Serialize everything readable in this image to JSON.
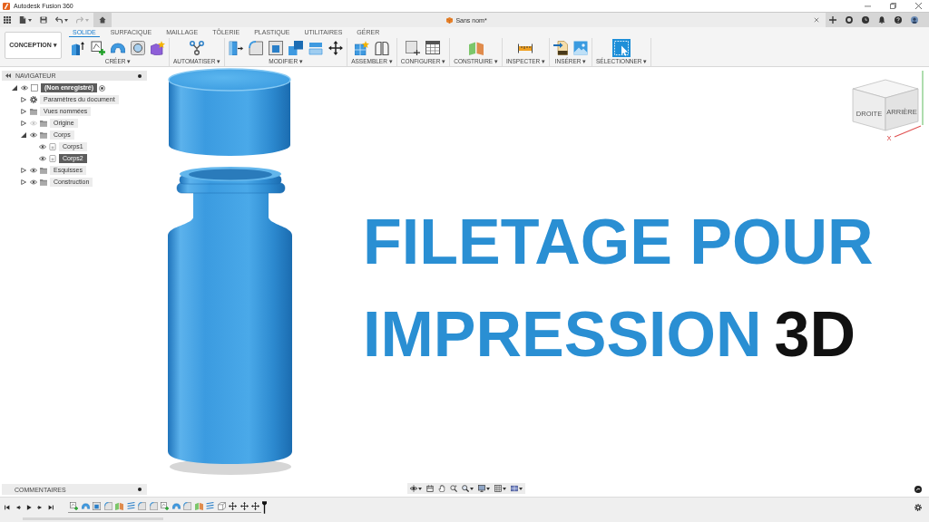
{
  "window": {
    "title": "Autodesk Fusion 360"
  },
  "quick_access": [
    {
      "kind": "apps",
      "dropdown": false,
      "disabled": false
    },
    {
      "kind": "file",
      "dropdown": true,
      "disabled": false
    },
    {
      "kind": "save",
      "dropdown": false,
      "disabled": false
    },
    {
      "kind": "undo",
      "dropdown": true,
      "disabled": false
    },
    {
      "kind": "redo",
      "dropdown": true,
      "disabled": true
    },
    {
      "kind": "home",
      "dropdown": false,
      "disabled": false
    }
  ],
  "document_tab": {
    "title": "Sans nom*"
  },
  "header_tools": [
    {
      "kind": "plus"
    },
    {
      "kind": "extensions"
    },
    {
      "kind": "jobs"
    },
    {
      "kind": "bell"
    },
    {
      "kind": "help"
    },
    {
      "kind": "avatar"
    }
  ],
  "workspace": {
    "label": "CONCEPTION ▾"
  },
  "tabs": [
    {
      "label": "SOLIDE",
      "selected": true
    },
    {
      "label": "SURFACIQUE",
      "selected": false
    },
    {
      "label": "MAILLAGE",
      "selected": false
    },
    {
      "label": "TÔLERIE",
      "selected": false
    },
    {
      "label": "PLASTIQUE",
      "selected": false
    },
    {
      "label": "UTILITAIRES",
      "selected": false
    },
    {
      "label": "GÉRER",
      "selected": false
    }
  ],
  "tool_groups": [
    {
      "label": "CRÉER ▾",
      "tools": [
        {
          "kind": "extrude"
        },
        {
          "kind": "sketch"
        },
        {
          "kind": "sweep"
        },
        {
          "kind": "hole"
        },
        {
          "kind": "form"
        }
      ]
    },
    {
      "label": "AUTOMATISER ▾",
      "tools": [
        {
          "kind": "automate"
        }
      ]
    },
    {
      "label": "MODIFIER ▾",
      "tools": [
        {
          "kind": "presspull"
        },
        {
          "kind": "fillet"
        },
        {
          "kind": "shell"
        },
        {
          "kind": "combine"
        },
        {
          "kind": "replace"
        },
        {
          "kind": "move"
        }
      ]
    },
    {
      "label": "ASSEMBLER ▾",
      "tools": [
        {
          "kind": "component"
        },
        {
          "kind": "joint"
        }
      ]
    },
    {
      "label": "CONFIGURER ▾",
      "tools": [
        {
          "kind": "parameters"
        },
        {
          "kind": "table"
        }
      ]
    },
    {
      "label": "CONSTRUIRE ▾",
      "tools": [
        {
          "kind": "plane"
        }
      ]
    },
    {
      "label": "INSPECTER ▾",
      "tools": [
        {
          "kind": "measure"
        }
      ]
    },
    {
      "label": "INSÉRER ▾",
      "tools": [
        {
          "kind": "insert"
        },
        {
          "kind": "image"
        }
      ]
    },
    {
      "label": "SÉLECTIONNER ▾",
      "tools": [
        {
          "kind": "select"
        }
      ]
    }
  ],
  "navigator": {
    "title": "NAVIGATEUR",
    "tree": [
      {
        "label": "(Non enregistré)",
        "kind": "document",
        "expanded": true,
        "visible": true,
        "selected": true,
        "children": [
          {
            "label": "Paramètres du document",
            "kind": "settings",
            "expanded": false,
            "selected": false
          },
          {
            "label": "Vues nommées",
            "kind": "folder",
            "expanded": false,
            "selected": false
          },
          {
            "label": "Origine",
            "kind": "folder",
            "expanded": false,
            "visible": false,
            "selected": false
          },
          {
            "label": "Corps",
            "kind": "folder",
            "expanded": true,
            "visible": true,
            "selected": false,
            "children": [
              {
                "label": "Corps1",
                "kind": "body",
                "visible": true,
                "selected": false
              },
              {
                "label": "Corps2",
                "kind": "body",
                "visible": true,
                "selected": true
              }
            ]
          },
          {
            "label": "Esquisses",
            "kind": "folder",
            "expanded": false,
            "visible": true,
            "selected": false
          },
          {
            "label": "Construction",
            "kind": "folder",
            "expanded": false,
            "visible": true,
            "selected": false
          }
        ]
      }
    ]
  },
  "viewcube": {
    "faces": [
      "DROITE",
      "ARRIÈRE"
    ],
    "axis": "X"
  },
  "headline": {
    "lines": [
      {
        "parts": [
          {
            "text": "FILETAGE POUR",
            "color": "#2a8fd3"
          }
        ]
      },
      {
        "parts": [
          {
            "text": "IMPRESSION",
            "color": "#2a8fd3"
          },
          {
            "text": "3D",
            "color": "#111111"
          }
        ]
      }
    ]
  },
  "comments": {
    "title": "COMMENTAIRES"
  },
  "nav_bar": [
    {
      "kind": "orbit",
      "dropdown": true
    },
    {
      "kind": "lookat",
      "dropdown": false
    },
    {
      "kind": "pan",
      "dropdown": false
    },
    {
      "kind": "zoom",
      "dropdown": false
    },
    {
      "kind": "fit",
      "dropdown": true
    },
    {
      "kind": "display",
      "dropdown": true
    },
    {
      "kind": "grid",
      "dropdown": true
    },
    {
      "kind": "viewports",
      "dropdown": true
    }
  ],
  "timeline": {
    "controls": [
      {
        "kind": "first"
      },
      {
        "kind": "prev"
      },
      {
        "kind": "play"
      },
      {
        "kind": "next"
      },
      {
        "kind": "last"
      }
    ],
    "features": [
      {
        "kind": "sketch"
      },
      {
        "kind": "sweep"
      },
      {
        "kind": "shell"
      },
      {
        "kind": "fillet"
      },
      {
        "kind": "plane"
      },
      {
        "kind": "thread"
      },
      {
        "kind": "fillet"
      },
      {
        "kind": "fillet"
      },
      {
        "kind": "sketch"
      },
      {
        "kind": "sweep"
      },
      {
        "kind": "fillet"
      },
      {
        "kind": "plane"
      },
      {
        "kind": "thread"
      },
      {
        "kind": "box"
      },
      {
        "kind": "move"
      },
      {
        "kind": "move"
      },
      {
        "kind": "move"
      }
    ]
  }
}
